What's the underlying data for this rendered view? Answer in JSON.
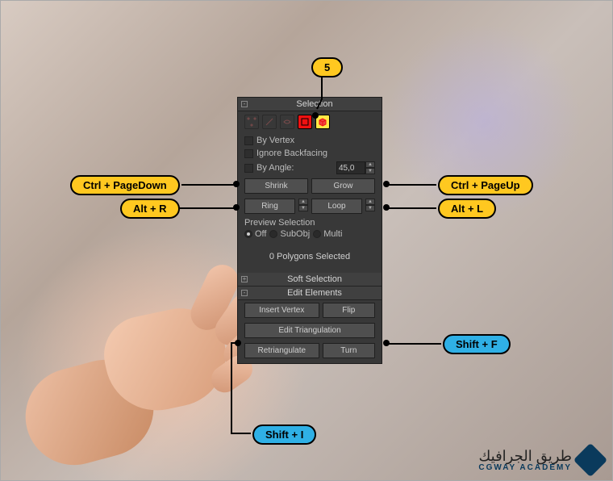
{
  "panel": {
    "selection": {
      "title": "Selection",
      "byVertex": "By Vertex",
      "ignoreBackfacing": "Ignore Backfacing",
      "byAngle": "By Angle:",
      "angleValue": "45,0",
      "shrink": "Shrink",
      "grow": "Grow",
      "ring": "Ring",
      "loop": "Loop",
      "previewLabel": "Preview Selection",
      "off": "Off",
      "subObj": "SubObj",
      "multi": "Multi",
      "status": "0 Polygons Selected"
    },
    "softSel": {
      "title": "Soft Selection"
    },
    "editEl": {
      "title": "Edit Elements",
      "insertVertex": "Insert Vertex",
      "flip": "Flip",
      "editTri": "Edit Triangulation",
      "retri": "Retriangulate",
      "turn": "Turn"
    }
  },
  "shortcuts": {
    "elementMode": "5",
    "shrink": "Ctrl + PageDown",
    "grow": "Ctrl + PageUp",
    "ring": "Alt + R",
    "loop": "Alt + L",
    "flip": "Shift + F",
    "insertVertex": "Shift + I"
  },
  "branding": {
    "arabic": "طريق الجرافيك",
    "latin": "CGWAY ACADEMY"
  },
  "colors": {
    "yellow": "#ffc820",
    "blue": "#2fb0e6"
  }
}
